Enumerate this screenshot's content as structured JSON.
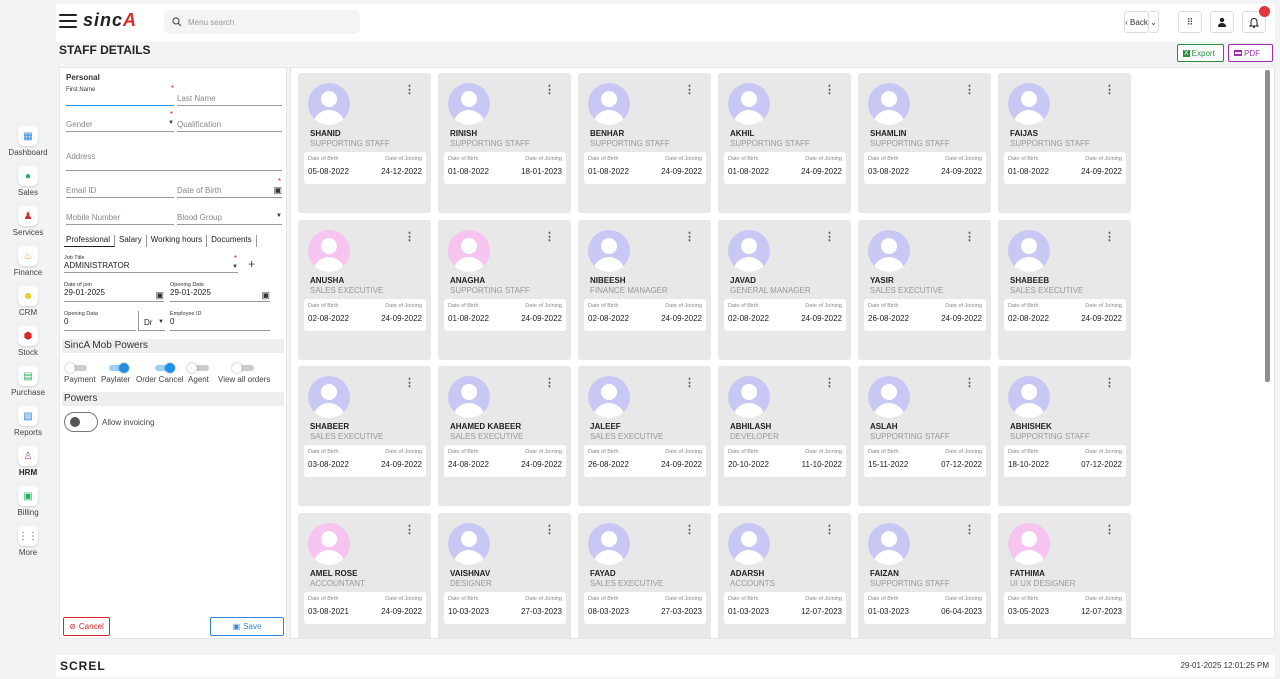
{
  "app": {
    "logo_main": "sinc",
    "logo_accent": "A",
    "footer_logo": "SCREL",
    "footer_time": "29-01-2025 12:01:25 PM"
  },
  "search": {
    "placeholder": "Menu search"
  },
  "topbar": {
    "back_label": "Back"
  },
  "page": {
    "title": "STAFF DETAILS",
    "export_label": "Export",
    "pdf_label": "PDF"
  },
  "sidebar": [
    {
      "label": "Dashboard",
      "icon": "dashboard-icon",
      "glyph": "▦",
      "color": "#2e86de"
    },
    {
      "label": "Sales",
      "icon": "sales-icon",
      "glyph": "●",
      "color": "#27ae60"
    },
    {
      "label": "Services",
      "icon": "services-icon",
      "glyph": "♟",
      "color": "#d62828"
    },
    {
      "label": "Finance",
      "icon": "finance-icon",
      "glyph": "♨",
      "color": "#e67e22"
    },
    {
      "label": "CRM",
      "icon": "crm-icon",
      "glyph": "☻",
      "color": "#f1c40f"
    },
    {
      "label": "Stock",
      "icon": "stock-icon",
      "glyph": "⬢",
      "color": "#d62828"
    },
    {
      "label": "Purchase",
      "icon": "purchase-icon",
      "glyph": "▤",
      "color": "#27ae60"
    },
    {
      "label": "Reports",
      "icon": "reports-icon",
      "glyph": "▧",
      "color": "#2e86de"
    },
    {
      "label": "HRM",
      "icon": "hrm-icon",
      "glyph": "♙",
      "color": "#9b59b6"
    },
    {
      "label": "Billing",
      "icon": "billing-icon",
      "glyph": "▣",
      "color": "#27ae60"
    },
    {
      "label": "More",
      "icon": "more-icon",
      "glyph": "⋮⋮",
      "color": "#555"
    }
  ],
  "form": {
    "section_personal": "Personal",
    "first_name_label": "First Name",
    "last_name_label": "Last Name",
    "gender_label": "Gender",
    "qualification_label": "Qualification",
    "address_label": "Address",
    "email_label": "Email ID",
    "dob_label": "Date of Birth",
    "mobile_label": "Mobile Number",
    "blood_group_label": "Blood Group",
    "tabs": [
      "Professional",
      "Salary",
      "Working hours",
      "Documents"
    ],
    "job_title_label": "Job Title",
    "job_title_value": "ADMINISTRATOR",
    "date_of_join_label": "Date of join",
    "date_of_join_value": "29-01-2025",
    "opening_date_label": "Opening Date",
    "opening_date_value": "29-01-2025",
    "opening_data_label": "Opening Data",
    "opening_data_value": "0",
    "dr_value": "Dr",
    "employee_id_label": "Employee ID",
    "employee_id_value": "0",
    "mob_powers_title": "SincA Mob Powers",
    "mob_powers": [
      {
        "label": "Payment",
        "on": false
      },
      {
        "label": "Paylater",
        "on": true
      },
      {
        "label": "Order Cancel",
        "on": true
      },
      {
        "label": "Agent",
        "on": false
      },
      {
        "label": "View all orders",
        "on": false
      }
    ],
    "powers_title": "Powers",
    "allow_invoicing_label": "Allow invoicing",
    "cancel_label": "Cancel",
    "save_label": "Save"
  },
  "card_labels": {
    "dob": "Date of Birth",
    "doj": "Date of Joining"
  },
  "avatar_colors": {
    "male": "#c9c8f5",
    "female": "#f7c3ef"
  },
  "staff": [
    {
      "name": "SHANID",
      "role": "SUPPORTING STAFF",
      "dob": "05-08-2022",
      "doj": "24-12-2022",
      "gender": "male"
    },
    {
      "name": "RINISH",
      "role": "SUPPORTING STAFF",
      "dob": "01-08-2022",
      "doj": "18-01-2023",
      "gender": "male"
    },
    {
      "name": "BENHAR",
      "role": "SUPPORTING STAFF",
      "dob": "01-08-2022",
      "doj": "24-09-2022",
      "gender": "male"
    },
    {
      "name": "AKHIL",
      "role": "SUPPORTING STAFF",
      "dob": "01-08-2022",
      "doj": "24-09-2022",
      "gender": "male"
    },
    {
      "name": "SHAMLIN",
      "role": "SUPPORTING STAFF",
      "dob": "03-08-2022",
      "doj": "24-09-2022",
      "gender": "male"
    },
    {
      "name": "FAIJAS",
      "role": "SUPPORTING STAFF",
      "dob": "01-08-2022",
      "doj": "24-09-2022",
      "gender": "male"
    },
    {
      "name": "ANUSHA",
      "role": "SALES EXECUTIVE",
      "dob": "02-08-2022",
      "doj": "24-09-2022",
      "gender": "female"
    },
    {
      "name": "ANAGHA",
      "role": "SUPPORTING STAFF",
      "dob": "01-08-2022",
      "doj": "24-09-2022",
      "gender": "female"
    },
    {
      "name": "NIBEESH",
      "role": "FINANCE MANAGER",
      "dob": "02-08-2022",
      "doj": "24-09-2022",
      "gender": "male"
    },
    {
      "name": "JAVAD",
      "role": "GENERAL MANAGER",
      "dob": "02-08-2022",
      "doj": "24-09-2022",
      "gender": "male"
    },
    {
      "name": "YASIR",
      "role": "SALES EXECUTIVE",
      "dob": "26-08-2022",
      "doj": "24-09-2022",
      "gender": "male"
    },
    {
      "name": "SHABEEB",
      "role": "SALES EXECUTIVE",
      "dob": "02-08-2022",
      "doj": "24-09-2022",
      "gender": "male"
    },
    {
      "name": "SHABEER",
      "role": "SALES EXECUTIVE",
      "dob": "03-08-2022",
      "doj": "24-09-2022",
      "gender": "male"
    },
    {
      "name": "AHAMED KABEER",
      "role": "SALES EXECUTIVE",
      "dob": "24-08-2022",
      "doj": "24-09-2022",
      "gender": "male"
    },
    {
      "name": "JALEEF",
      "role": "SALES EXECUTIVE",
      "dob": "26-08-2022",
      "doj": "24-09-2022",
      "gender": "male"
    },
    {
      "name": "ABHILASH",
      "role": "DEVELOPER",
      "dob": "20-10-2022",
      "doj": "11-10-2022",
      "gender": "male"
    },
    {
      "name": "ASLAH",
      "role": "SUPPORTING STAFF",
      "dob": "15-11-2022",
      "doj": "07-12-2022",
      "gender": "male"
    },
    {
      "name": "ABHISHEK",
      "role": "SUPPORTING STAFF",
      "dob": "18-10-2022",
      "doj": "07-12-2022",
      "gender": "male"
    },
    {
      "name": "AMEL ROSE",
      "role": "ACCOUNTANT",
      "dob": "03-08-2021",
      "doj": "24-09-2022",
      "gender": "female"
    },
    {
      "name": "VAISHNAV",
      "role": "DESIGNER",
      "dob": "10-03-2023",
      "doj": "27-03-2023",
      "gender": "male"
    },
    {
      "name": "FAYAD",
      "role": "SALES EXECUTIVE",
      "dob": "08-03-2023",
      "doj": "27-03-2023",
      "gender": "male"
    },
    {
      "name": "ADARSH",
      "role": "ACCOUNTS",
      "dob": "01-03-2023",
      "doj": "12-07-2023",
      "gender": "male"
    },
    {
      "name": "FAIZAN",
      "role": "SUPPORTING STAFF",
      "dob": "01-03-2023",
      "doj": "06-04-2023",
      "gender": "male"
    },
    {
      "name": "FATHIMA",
      "role": "UI UX DESIGNER",
      "dob": "03-05-2023",
      "doj": "12-07-2023",
      "gender": "female"
    }
  ]
}
